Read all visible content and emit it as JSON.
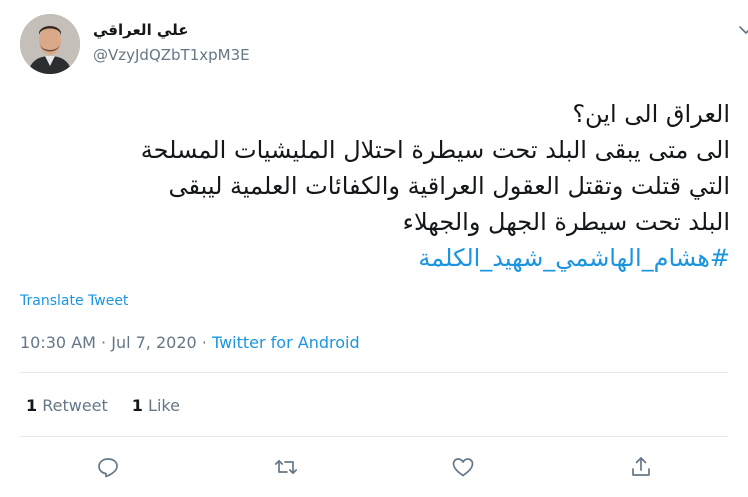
{
  "author": {
    "display_name": "علي العراقي",
    "handle": "@VzyJdQZbT1xpM3E"
  },
  "tweet": {
    "lines": [
      "العراق الى اين؟",
      "الى متى يبقى البلد تحت سيطرة احتلال المليشيات المسلحة",
      "التي قتلت وتقتل العقول العراقية والكفائات العلمية ليبقى",
      "البلد تحت سيطرة الجهل والجهلاء"
    ],
    "hashtag": "#هشام_الهاشمي_شهيد_الكلمة"
  },
  "translate_label": "Translate Tweet",
  "meta": {
    "time": "10:30 AM",
    "separator1": " · ",
    "date": "Jul 7, 2020",
    "separator2": " · ",
    "source": "Twitter for Android"
  },
  "stats": {
    "retweet_count": "1",
    "retweet_label": "Retweet",
    "like_count": "1",
    "like_label": "Like"
  },
  "icons": {
    "caret": "chevron-down-icon",
    "reply": "reply-icon",
    "retweet": "retweet-icon",
    "like": "heart-icon",
    "share": "share-icon"
  },
  "colors": {
    "link": "#1b95e0",
    "secondary": "#657786",
    "primary": "#14171a",
    "divider": "#e6ecf0"
  }
}
